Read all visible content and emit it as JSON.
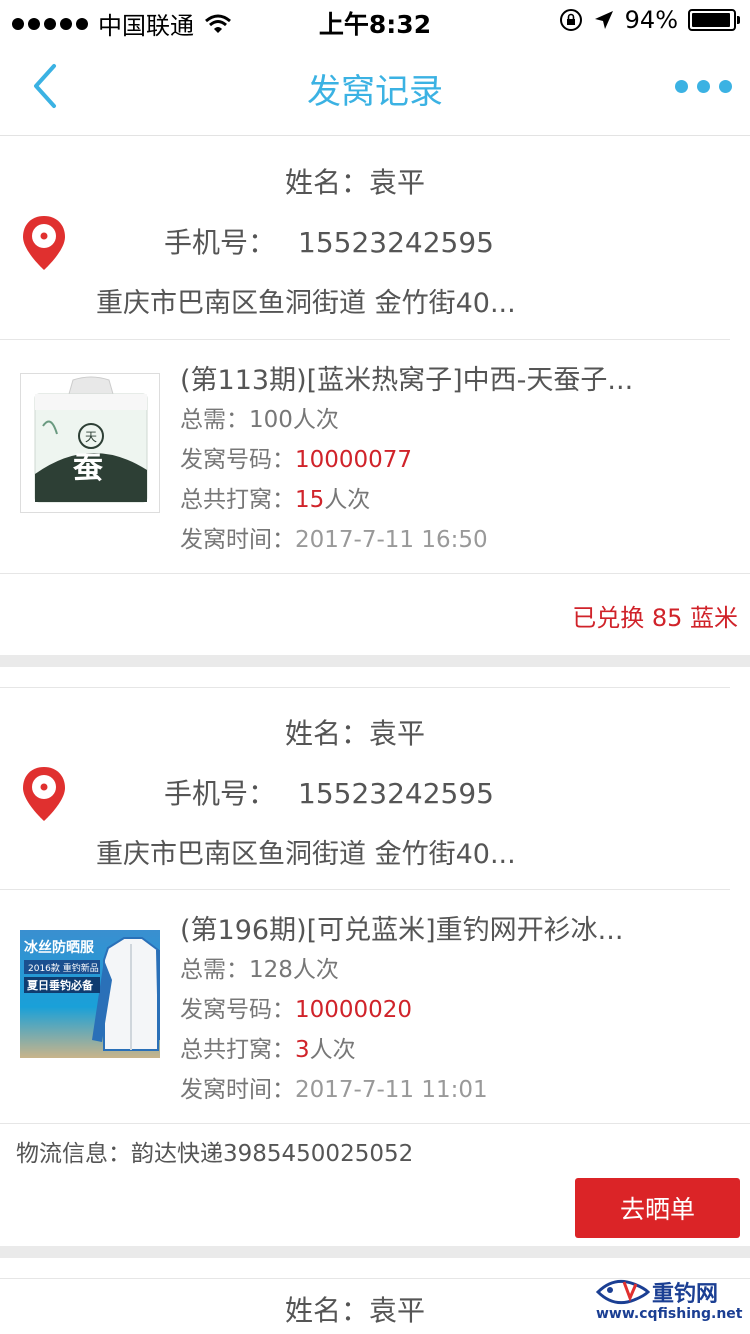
{
  "status_bar": {
    "carrier": "中国联通",
    "time": "上午8:32",
    "battery": "94%",
    "battery_level": 0.94
  },
  "nav": {
    "title": "发窝记录"
  },
  "records": [
    {
      "name_label": "姓名：",
      "name": "袁平",
      "phone_label": "手机号：",
      "phone": "15523242595",
      "address": "重庆市巴南区鱼洞街道 金竹街40...",
      "goods_title": "(第113期)[蓝米热窝子]中西-天蚕子...",
      "need_label": "总需：",
      "need": "100人次",
      "code_label": "发窝号码：",
      "code": "10000077",
      "total_label": "总共打窝：",
      "total_num": "15",
      "total_unit": "人次",
      "time_label": "发窝时间：",
      "time": "2017-7-11 16:50",
      "exchanged": "已兑换 85 蓝米"
    },
    {
      "name_label": "姓名：",
      "name": "袁平",
      "phone_label": "手机号：",
      "phone": "15523242595",
      "address": "重庆市巴南区鱼洞街道 金竹街40...",
      "goods_title": "(第196期)[可兑蓝米]重钓网开衫冰...",
      "need_label": "总需：",
      "need": "128人次",
      "code_label": "发窝号码：",
      "code": "10000020",
      "total_label": "总共打窝：",
      "total_num": "3",
      "total_unit": "人次",
      "time_label": "发窝时间：",
      "time": "2017-7-11 11:01",
      "logistics": "物流信息：韵达快递3985450025052",
      "show_button": "去晒单",
      "thumb_text_1": "冰丝防晒服",
      "thumb_text_2": "2016款 重钓新品",
      "thumb_text_3": "夏日垂钓必备"
    },
    {
      "name_label": "姓名：",
      "name": "袁平"
    }
  ],
  "watermark": {
    "brand": "重钓网",
    "url": "www.cqfishing.net"
  },
  "colors": {
    "accent": "#3bb2e3",
    "red": "#d0232a",
    "button": "#db2427"
  }
}
